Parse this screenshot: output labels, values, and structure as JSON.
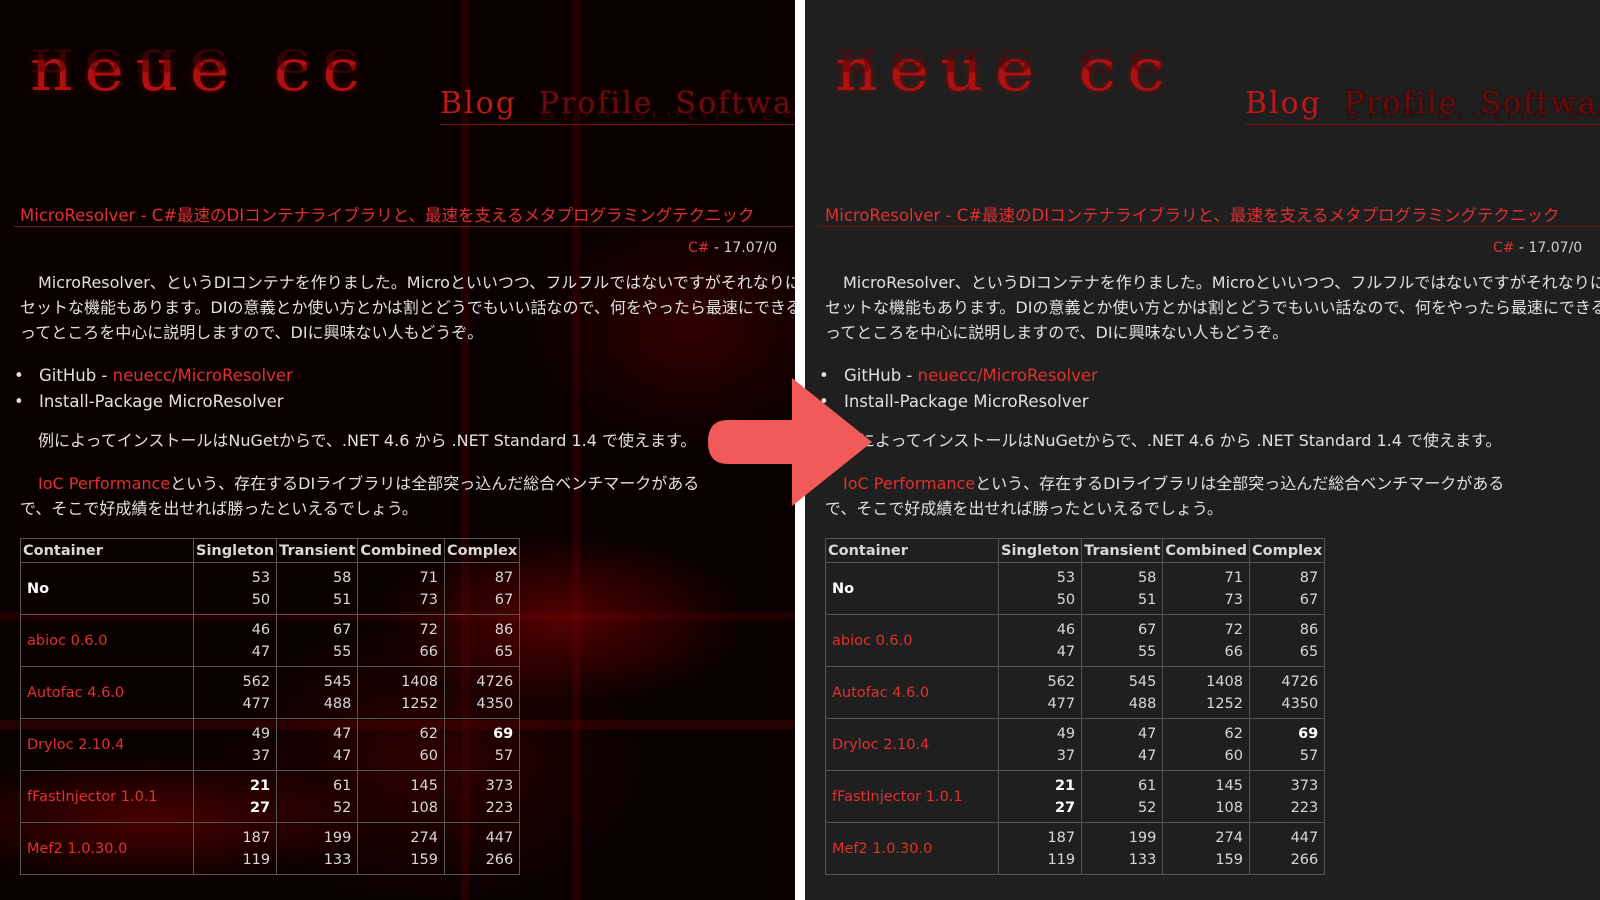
{
  "site": {
    "logo": "neue cc",
    "nav": [
      "Blog",
      "Profile",
      "Software"
    ]
  },
  "post": {
    "title": "MicroResolver - C#最速のDIコンテナライブラリと、最速を支えるメタプログラミングテクニック",
    "tag": "C#",
    "date": "17.07/0",
    "para1": [
      "MicroResolver、というDIコンテナを作りました。Microといいつつ、フルフルではないですがそれなりにフ",
      "セットな機能もあります。DIの意義とか使い方とかは割とどうでもいい話なので、何をやったら最速にできるのか",
      "ってところを中心に説明しますので、DIに興味ない人もどうぞ。"
    ],
    "bullets": [
      {
        "prefix": "GitHub - ",
        "link": "neuecc/MicroResolver"
      },
      {
        "prefix": "Install-Package MicroResolver",
        "link": ""
      }
    ],
    "para2": "例によってインストールはNuGetからで、.NET 4.6 から .NET Standard 1.4 で使えます。",
    "para3_link": "IoC Performance",
    "para3_rest": "という、存在するDIライブラリは全部突っ込んだ総合ベンチマークがある",
    "para3_line2": "で、そこで好成績を出せれば勝ったといえるでしょう。"
  },
  "table": {
    "headers": [
      "Container",
      "Singleton",
      "Transient",
      "Combined",
      "Complex"
    ],
    "rows": [
      {
        "name": "No",
        "style": "black",
        "vals": [
          [
            "53",
            "50"
          ],
          [
            "58",
            "51"
          ],
          [
            "71",
            "73"
          ],
          [
            "87",
            "67"
          ]
        ],
        "bold": []
      },
      {
        "name": "abioc 0.6.0",
        "style": "red",
        "vals": [
          [
            "46",
            "47"
          ],
          [
            "67",
            "55"
          ],
          [
            "72",
            "66"
          ],
          [
            "86",
            "65"
          ]
        ],
        "bold": []
      },
      {
        "name": "Autofac 4.6.0",
        "style": "red",
        "vals": [
          [
            "562",
            "477"
          ],
          [
            "545",
            "488"
          ],
          [
            "1408",
            "1252"
          ],
          [
            "4726",
            "4350"
          ]
        ],
        "bold": []
      },
      {
        "name": "Dryloc 2.10.4",
        "style": "red",
        "vals": [
          [
            "49",
            "37"
          ],
          [
            "47",
            "47"
          ],
          [
            "62",
            "60"
          ],
          [
            "69",
            "57"
          ]
        ],
        "bold": [
          "3-0"
        ]
      },
      {
        "name": "fFastInjector 1.0.1",
        "style": "red",
        "vals": [
          [
            "21",
            "27"
          ],
          [
            "61",
            "52"
          ],
          [
            "145",
            "108"
          ],
          [
            "373",
            "223"
          ]
        ],
        "bold": [
          "0-0",
          "0-1"
        ]
      },
      {
        "name": "Mef2 1.0.30.0",
        "style": "red",
        "vals": [
          [
            "187",
            "119"
          ],
          [
            "199",
            "133"
          ],
          [
            "274",
            "159"
          ],
          [
            "447",
            "266"
          ]
        ],
        "bold": []
      }
    ]
  },
  "colors": {
    "left_bg": "#0b0000",
    "right_bg": "#1f1f1f",
    "accent_red": "#e03030",
    "arrow": "#f25a5a"
  },
  "icons": [
    "arrow-right-icon"
  ]
}
